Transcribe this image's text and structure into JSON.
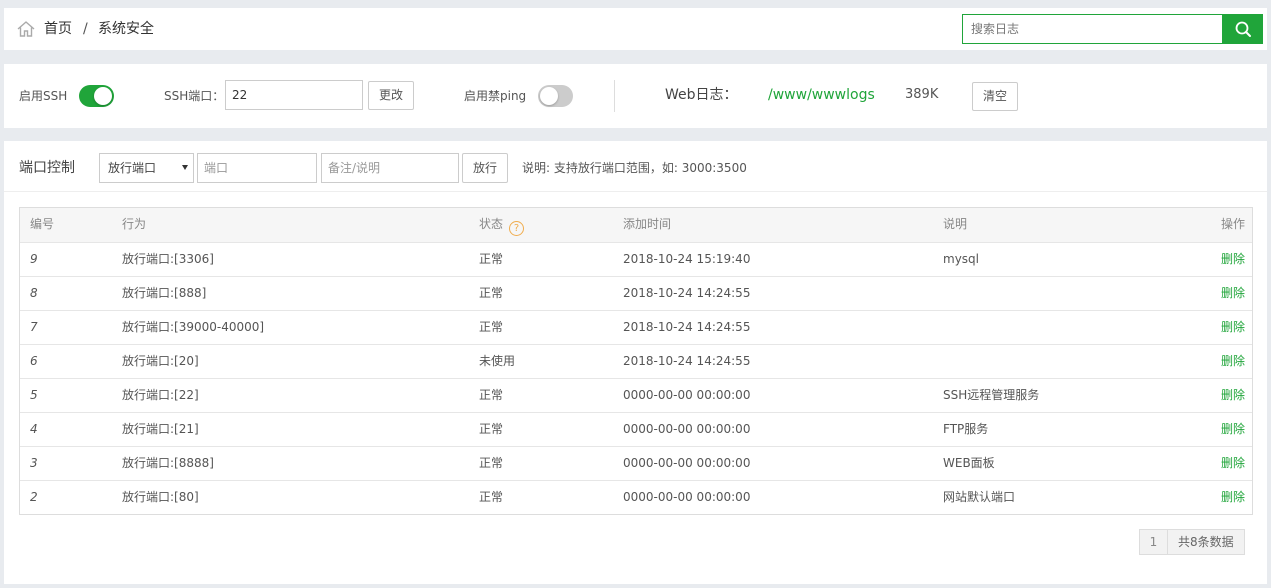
{
  "header": {
    "home_label": "首页",
    "separator": "/",
    "current": "系统安全",
    "search_placeholder": "搜索日志"
  },
  "toolbar": {
    "ssh_enable_label": "启用SSH",
    "ssh_enabled": true,
    "ssh_port_label": "SSH端口：",
    "ssh_port_value": "22",
    "change_button": "更改",
    "ping_label": "启用禁ping",
    "ping_enabled": false,
    "weblog_label": "Web日志：",
    "weblog_path": "/www/wwwlogs",
    "weblog_size": "389K",
    "clear_button": "清空"
  },
  "port_control": {
    "title": "端口控制",
    "select_value": "放行端口",
    "port_placeholder": "端口",
    "note_placeholder": "备注/说明",
    "submit_button": "放行",
    "hint": "说明: 支持放行端口范围，如: 3000:3500"
  },
  "table": {
    "headers": {
      "id": "编号",
      "action": "行为",
      "status": "状态",
      "help": "?",
      "time": "添加时间",
      "desc": "说明",
      "op": "操作"
    },
    "rows": [
      {
        "id": "9",
        "action": "放行端口:[3306]",
        "status": "正常",
        "time": "2018-10-24 15:19:40",
        "desc": "mysql",
        "op": "删除"
      },
      {
        "id": "8",
        "action": "放行端口:[888]",
        "status": "正常",
        "time": "2018-10-24 14:24:55",
        "desc": "",
        "op": "删除"
      },
      {
        "id": "7",
        "action": "放行端口:[39000-40000]",
        "status": "正常",
        "time": "2018-10-24 14:24:55",
        "desc": "",
        "op": "删除"
      },
      {
        "id": "6",
        "action": "放行端口:[20]",
        "status": "未使用",
        "time": "2018-10-24 14:24:55",
        "desc": "",
        "op": "删除"
      },
      {
        "id": "5",
        "action": "放行端口:[22]",
        "status": "正常",
        "time": "0000-00-00 00:00:00",
        "desc": "SSH远程管理服务",
        "op": "删除"
      },
      {
        "id": "4",
        "action": "放行端口:[21]",
        "status": "正常",
        "time": "0000-00-00 00:00:00",
        "desc": "FTP服务",
        "op": "删除"
      },
      {
        "id": "3",
        "action": "放行端口:[8888]",
        "status": "正常",
        "time": "0000-00-00 00:00:00",
        "desc": "WEB面板",
        "op": "删除"
      },
      {
        "id": "2",
        "action": "放行端口:[80]",
        "status": "正常",
        "time": "0000-00-00 00:00:00",
        "desc": "网站默认端口",
        "op": "删除"
      }
    ]
  },
  "pagination": {
    "current_page": "1",
    "total_text": "共8条数据"
  },
  "colors": {
    "accent": "#20a53a",
    "help": "#f0ad4e"
  }
}
